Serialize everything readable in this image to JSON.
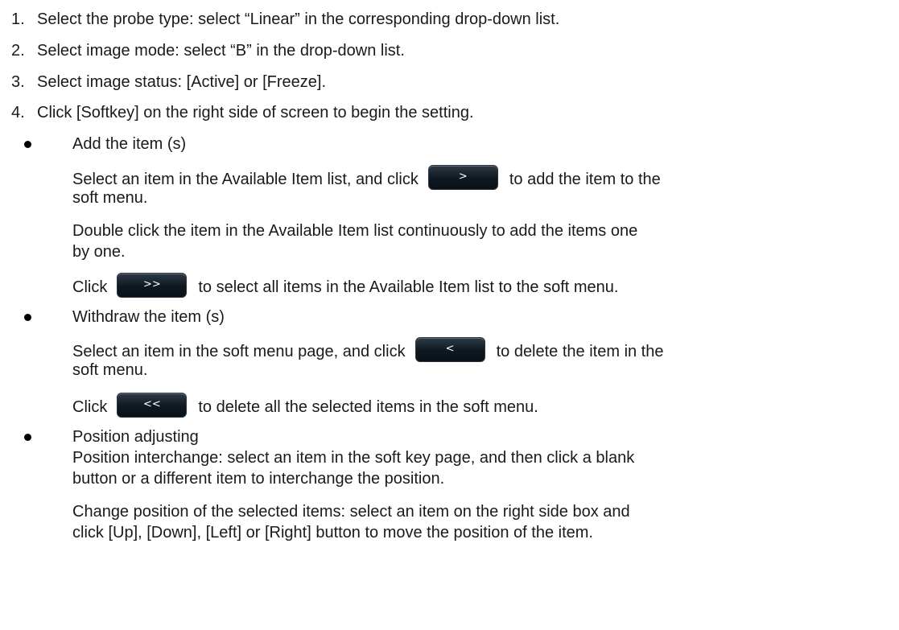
{
  "steps": [
    {
      "num": "1.",
      "text": "Select the probe type: select “Linear” in the corresponding drop-down list."
    },
    {
      "num": "2.",
      "text": "Select image mode: select “B” in the drop-down list."
    },
    {
      "num": "3.",
      "text": "Select image status: [Active] or [Freeze]."
    },
    {
      "num": "4.",
      "text": "Click [Softkey] on the right side of screen to begin the setting."
    }
  ],
  "add": {
    "title": "Add the item (s)",
    "p1_before": "Select an item in the Available Item list, and click",
    "p1_button": ">",
    "p1_after": "to add the item to the",
    "p1_line2": "soft menu.",
    "p2_line1": "Double click the item in the Available Item list continuously to add the items one",
    "p2_line2": "by one.",
    "p3_before": "Click",
    "p3_button": ">>",
    "p3_after": "to select all items in the Available Item list to the soft menu."
  },
  "withdraw": {
    "title": "Withdraw the item (s)",
    "p1_before": "Select an item in the soft menu page, and click",
    "p1_button": "<",
    "p1_after": "to delete the item in the",
    "p1_line2": "soft menu.",
    "p2_before": "Click",
    "p2_button": "<<",
    "p2_after": "to delete all the selected items in the soft menu."
  },
  "position": {
    "title": "Position adjusting",
    "p1_line1": "Position interchange: select an item in the soft key page, and then click a blank",
    "p1_line2": "button or a different item to interchange the position.",
    "p2_line1": "Change position of the selected items: select an item on the right side box and",
    "p2_line2": "click [Up], [Down], [Left] or [Right] button to move the position of the item."
  }
}
